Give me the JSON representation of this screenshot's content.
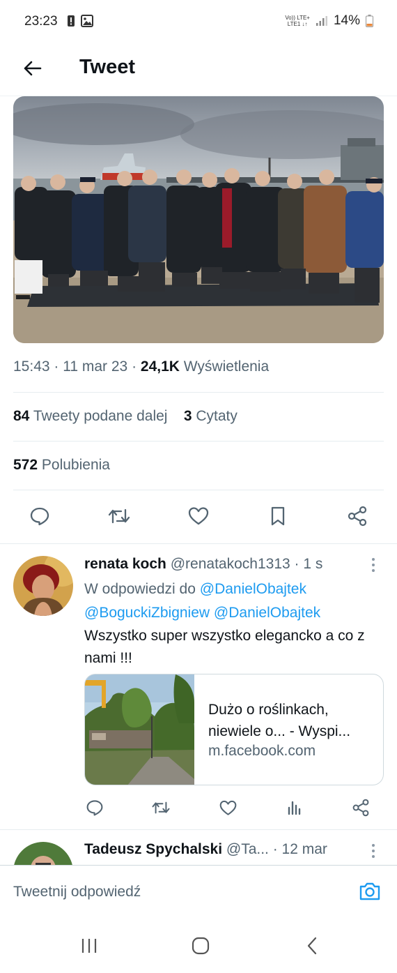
{
  "status_bar": {
    "time": "23:23",
    "network_top": "Vo)) LTE+",
    "network_bottom": "LTE1 ↓↑",
    "battery": "14%",
    "icons": [
      "alert-icon",
      "gallery-icon",
      "signal-icon",
      "battery-icon"
    ]
  },
  "header": {
    "back_icon": "arrow-left-icon",
    "title": "Tweet"
  },
  "tweet": {
    "image_icon": "photo",
    "time": "15:43",
    "date": "11 mar 23",
    "views_count": "24,1K",
    "views_label": "Wyświetlenia",
    "retweets_count": "84",
    "retweets_label": "Tweety podane dalej",
    "quotes_count": "3",
    "quotes_label": "Cytaty",
    "likes_count": "572",
    "likes_label": "Polubienia",
    "actions": [
      "reply-icon",
      "retweet-icon",
      "like-icon",
      "bookmark-icon",
      "share-icon"
    ]
  },
  "reply": {
    "name": "renata koch",
    "handle": "@renatakoch1313",
    "time": "· 1 s",
    "reply_to_label": "W odpowiedzi do",
    "mentions": [
      "@DanielObajtek",
      "@BoguckiZbigniew",
      "@DanielObajtek"
    ],
    "body": "Wszystko super wszystko elegancko a co z nami !!!",
    "card": {
      "title": "Dużo o roślinkach, niewiele o... - Wyspi...",
      "domain": "m.facebook.com"
    },
    "actions": [
      "reply-icon",
      "retweet-icon",
      "like-icon",
      "views-icon",
      "share-icon"
    ]
  },
  "reply2": {
    "name": "Tadeusz Spychalski",
    "handle": "@Ta...",
    "time": "· 12 mar"
  },
  "compose": {
    "placeholder": "Tweetnij odpowiedź"
  },
  "colors": {
    "accent": "#1d9bf0",
    "text_primary": "#0f1419",
    "text_secondary": "#536471",
    "divider": "#e6ecf0"
  }
}
